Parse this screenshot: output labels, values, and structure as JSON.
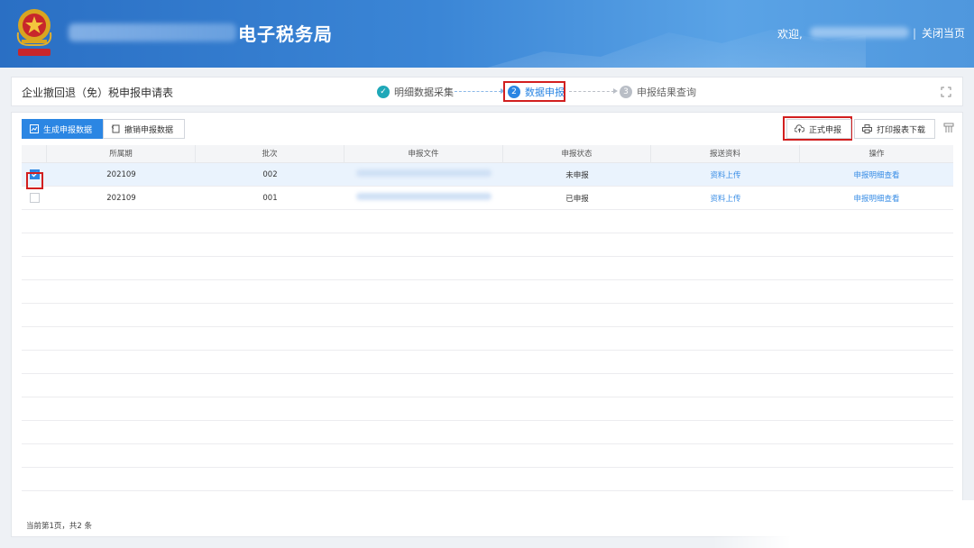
{
  "header": {
    "title": "电子税务局",
    "welcome": "欢迎,",
    "close_page": "关闭当页"
  },
  "stepbar": {
    "page_title": "企业撤回退（免）税申报申请表",
    "steps": [
      {
        "num": "✓",
        "label": "明细数据采集",
        "state": "done"
      },
      {
        "num": "2",
        "label": "数据申报",
        "state": "active"
      },
      {
        "num": "3",
        "label": "申报结果查询",
        "state": "pending"
      }
    ]
  },
  "toolbar": {
    "generate": "生成申报数据",
    "revoke": "撤销申报数据",
    "submit": "正式申报",
    "print": "打印报表下载"
  },
  "table": {
    "columns": [
      "",
      "所属期",
      "批次",
      "申报文件",
      "申报状态",
      "报送资料",
      "操作"
    ],
    "rows": [
      {
        "checked": true,
        "period": "202109",
        "batch": "002",
        "status": "未申报",
        "upload": "资料上传",
        "action": "申报明细查看"
      },
      {
        "checked": false,
        "period": "202109",
        "batch": "001",
        "status": "已申报",
        "upload": "资料上传",
        "action": "申报明细查看"
      }
    ]
  },
  "footer": {
    "pagination": "当前第1页，共2 条"
  },
  "colors": {
    "accent": "#2b86e3",
    "highlight": "#d21f1f",
    "header": "#3b86d6"
  }
}
